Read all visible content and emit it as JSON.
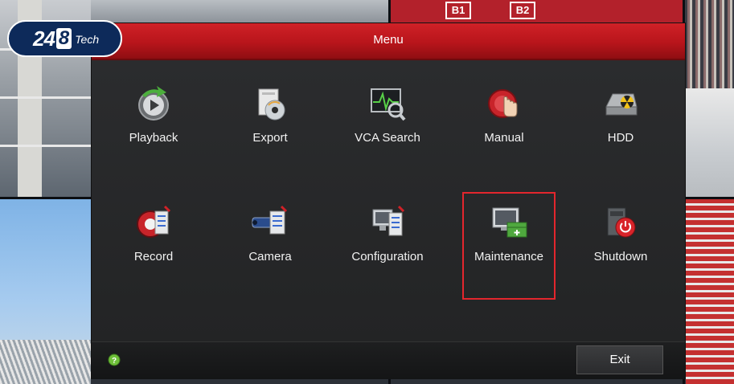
{
  "logo": {
    "digits_a": "24",
    "digit_b": "8",
    "suffix": "Tech"
  },
  "background_signs": [
    "B1",
    "B2"
  ],
  "window": {
    "title": "Menu"
  },
  "menu_items": [
    {
      "label": "Playback",
      "icon": "playback-icon"
    },
    {
      "label": "Export",
      "icon": "export-icon"
    },
    {
      "label": "VCA Search",
      "icon": "vca-search-icon"
    },
    {
      "label": "Manual",
      "icon": "manual-icon"
    },
    {
      "label": "HDD",
      "icon": "hdd-icon"
    },
    {
      "label": "Record",
      "icon": "record-icon"
    },
    {
      "label": "Camera",
      "icon": "camera-icon"
    },
    {
      "label": "Configuration",
      "icon": "configuration-icon"
    },
    {
      "label": "Maintenance",
      "icon": "maintenance-icon",
      "selected": true
    },
    {
      "label": "Shutdown",
      "icon": "shutdown-icon"
    }
  ],
  "footer": {
    "help_icon": "help-icon",
    "exit_label": "Exit"
  },
  "colors": {
    "title_bar": "#c41a20",
    "highlight": "#e3262d",
    "panel": "#262728"
  }
}
